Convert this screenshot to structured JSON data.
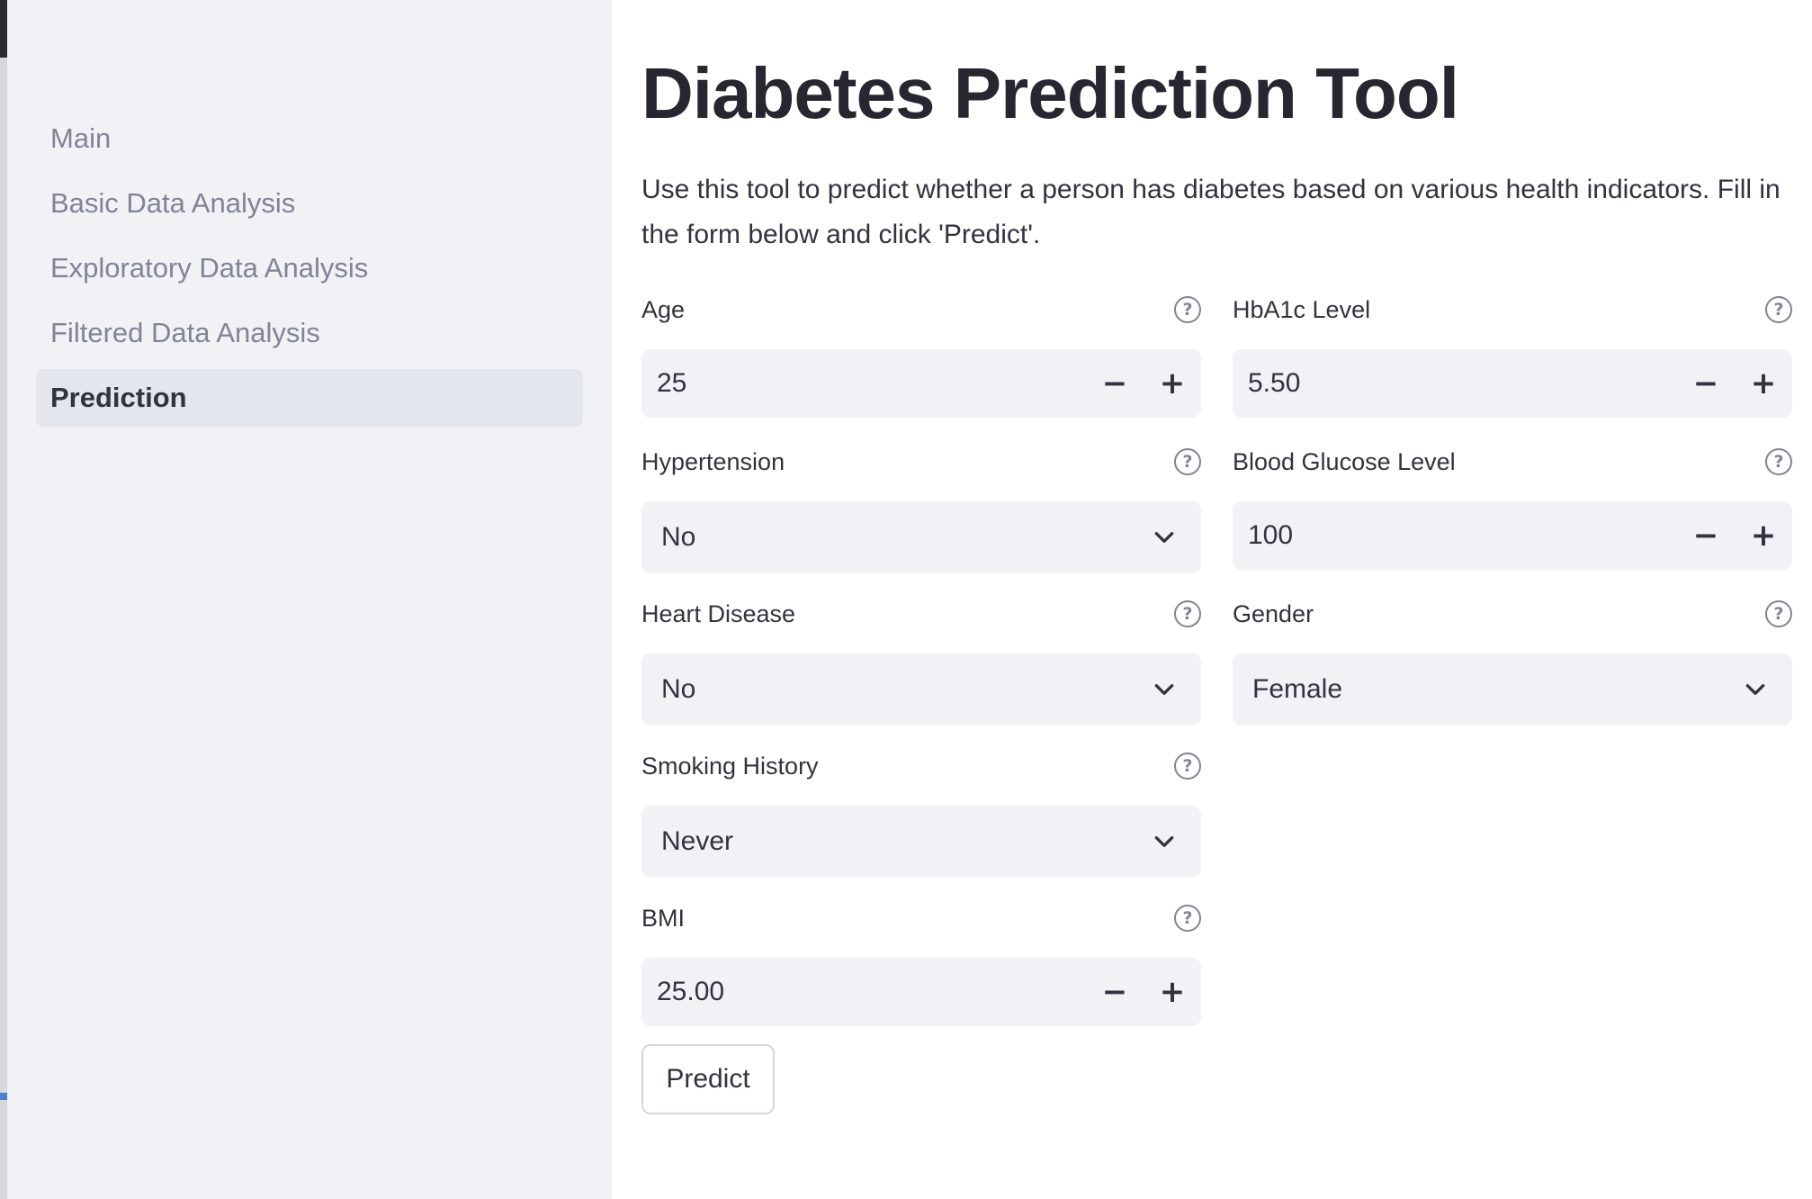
{
  "sidebar": {
    "items": [
      {
        "label": "Main"
      },
      {
        "label": "Basic Data Analysis"
      },
      {
        "label": "Exploratory Data Analysis"
      },
      {
        "label": "Filtered Data Analysis"
      },
      {
        "label": "Prediction",
        "active": true
      }
    ]
  },
  "page": {
    "title": "Diabetes Prediction Tool",
    "intro": "Use this tool to predict whether a person has diabetes based on various health indicators. Fill in the form below and click 'Predict'."
  },
  "form": {
    "age": {
      "label": "Age",
      "value": "25"
    },
    "hypertension": {
      "label": "Hypertension",
      "value": "No"
    },
    "heart_disease": {
      "label": "Heart Disease",
      "value": "No"
    },
    "smoking_history": {
      "label": "Smoking History",
      "value": "Never"
    },
    "bmi": {
      "label": "BMI",
      "value": "25.00"
    },
    "hba1c": {
      "label": "HbA1c Level",
      "value": "5.50"
    },
    "blood_glucose": {
      "label": "Blood Glucose Level",
      "value": "100"
    },
    "gender": {
      "label": "Gender",
      "value": "Female"
    },
    "help_symbol": "?",
    "minus_symbol": "−",
    "plus_symbol": "+",
    "predict_label": "Predict"
  },
  "icons": {
    "help": "help-circle-icon",
    "chevron": "chevron-down-icon",
    "minus": "minus-icon",
    "plus": "plus-icon"
  },
  "colors": {
    "sidebar_bg": "#f0f2f6",
    "input_bg": "#f0f2f6",
    "text": "#31333f",
    "muted": "#808495",
    "active_nav_bg": "#e3e6ed"
  }
}
